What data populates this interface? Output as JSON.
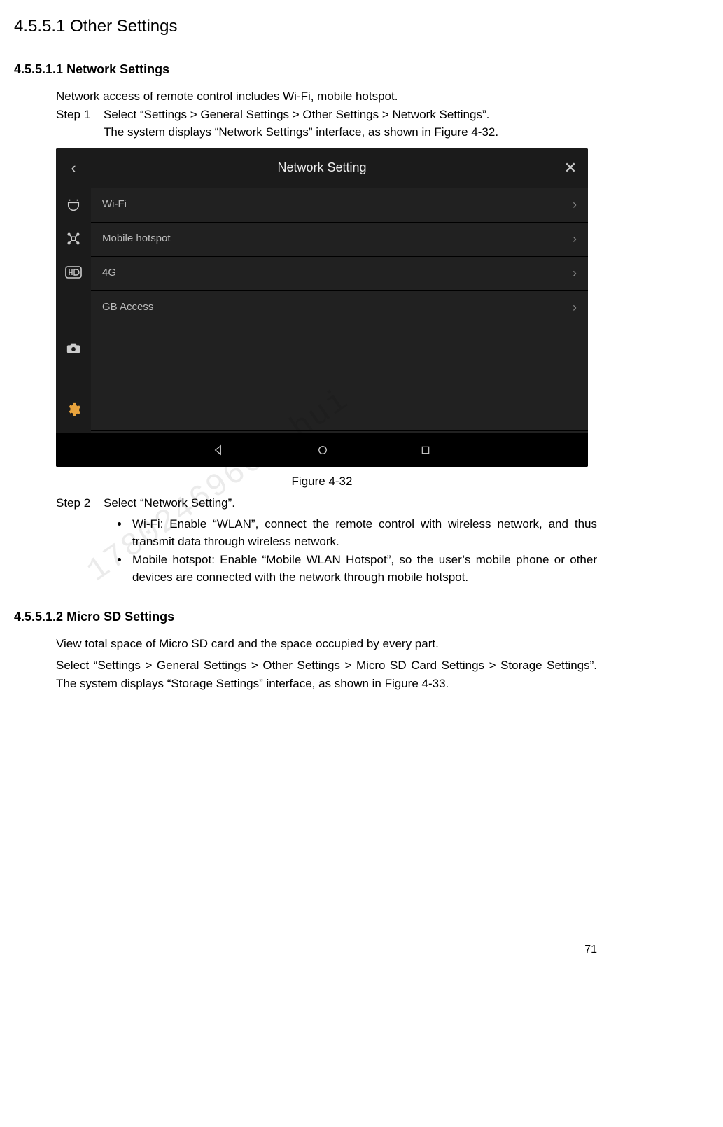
{
  "section_heading": "4.5.5.1 Other Settings",
  "subsection1": {
    "number": "4.5.5.1.1",
    "title": "Network Settings",
    "intro": "Network access of remote control includes Wi-Fi, mobile hotspot.",
    "step1_label": "Step 1",
    "step1_line1": "Select “Settings > General Settings > Other Settings > Network Settings”.",
    "step1_line2": "The system displays “Network Settings” interface, as shown in Figure 4-32.",
    "figure_caption": "Figure 4-32",
    "step2_label": "Step 2",
    "step2_text": "Select “Network Setting”.",
    "bullets": [
      "Wi-Fi: Enable “WLAN”, connect the remote control with wireless network, and thus transmit data through wireless network.",
      "Mobile hotspot: Enable “Mobile WLAN Hotspot”, so the user’s mobile phone or other devices are connected with the network through mobile hotspot."
    ]
  },
  "screenshot": {
    "title": "Network Setting",
    "back": "‹",
    "close": "✕",
    "rows": [
      "Wi-Fi",
      "Mobile hotspot",
      "4G",
      "GB Access"
    ],
    "chevron": "›"
  },
  "subsection2": {
    "number": "4.5.5.1.2",
    "title": "Micro SD Settings",
    "p1": "View total space of Micro SD card and the space occupied by every part.",
    "p2": "Select “Settings > General Settings > Other Settings > Micro SD Card Settings > Storage Settings”. The system displays “Storage Settings” interface, as shown in Figure 4-33."
  },
  "page_number": "71",
  "watermark": "17802469664 hui"
}
